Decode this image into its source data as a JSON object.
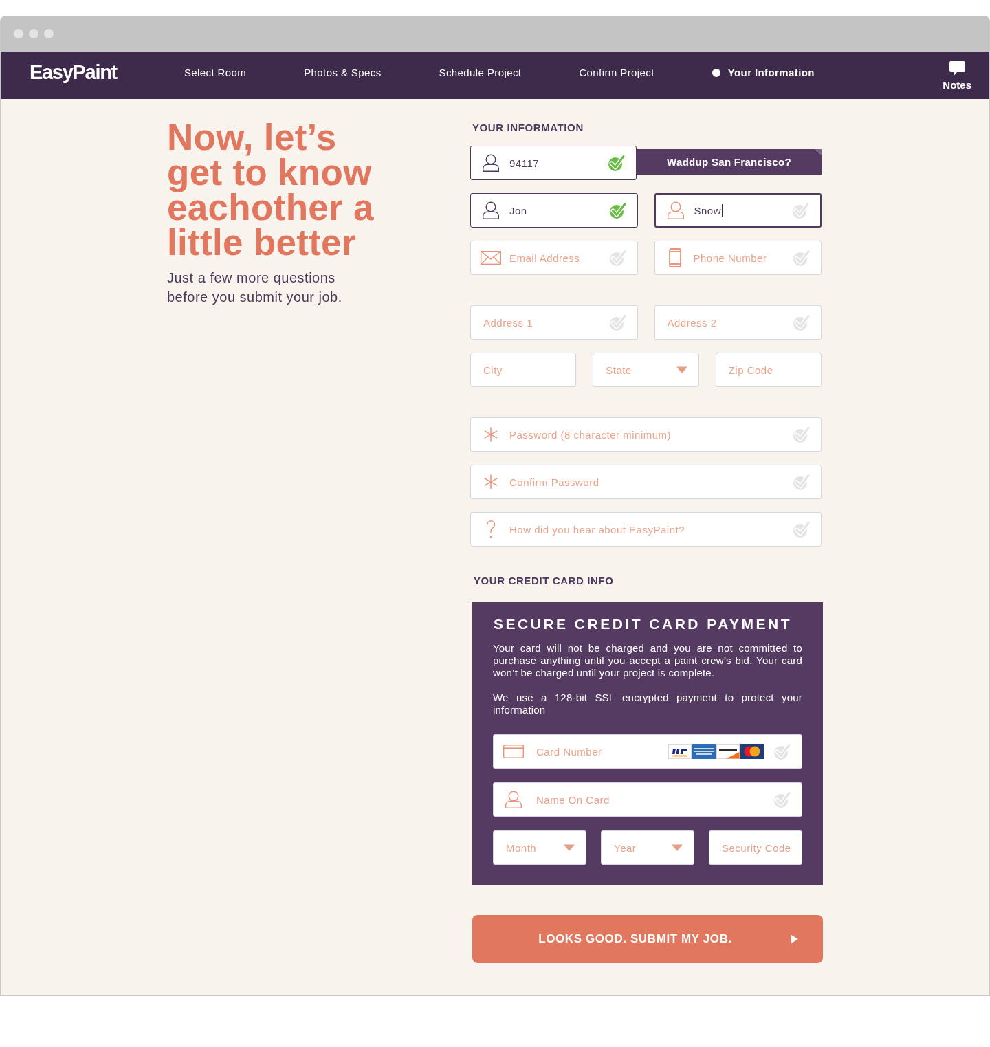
{
  "nav": {
    "logo": "EasyPaint",
    "steps": [
      {
        "label": "Select Room",
        "selected": false
      },
      {
        "label": "Photos & Specs",
        "selected": false
      },
      {
        "label": "Schedule Project",
        "selected": false
      },
      {
        "label": "Confirm Project",
        "selected": false
      },
      {
        "label": "Your Information",
        "selected": true
      }
    ],
    "notes": {
      "label": "Notes"
    }
  },
  "intro": {
    "heading": "Now, let’s\nget to know\neachother a\nlittle better",
    "subtitle": "Just a few more questions before you submit your job."
  },
  "your_information": {
    "title": "YOUR INFORMATION",
    "sections": [
      {
        "rows": [
          {
            "tooltip": "Waddup San Francisco?",
            "fields": [
              {
                "kind": "zip",
                "value": "94117",
                "valid": true,
                "focused": false
              }
            ]
          },
          {
            "fields": [
              {
                "kind": "name",
                "value": "Jon",
                "valid": true,
                "focused": false
              },
              {
                "kind": "name",
                "value": "Snow",
                "valid": false,
                "focused": true
              }
            ]
          },
          {
            "fields": [
              {
                "kind": "email",
                "placeholder": "Email Address",
                "valid": false,
                "focused": false
              },
              {
                "kind": "phone",
                "placeholder": "Phone Number",
                "valid": false,
                "focused": false
              }
            ]
          }
        ]
      },
      {
        "rows": [
          {
            "fields": [
              {
                "kind": "address",
                "placeholder": "Address 1",
                "valid": false,
                "focused": false
              },
              {
                "kind": "address",
                "placeholder": "Address 2",
                "valid": false,
                "focused": false
              }
            ]
          },
          {
            "fields": [
              {
                "kind": "city",
                "placeholder": "City",
                "focused": false
              },
              {
                "kind": "state",
                "placeholder": "State",
                "focused": false
              },
              {
                "kind": "postcode",
                "placeholder": "Zip Code",
                "focused": false
              }
            ]
          }
        ]
      },
      {
        "rows": [
          {
            "fields": [
              {
                "kind": "password",
                "placeholder": "Password (8 character minimum)",
                "valid": false,
                "focused": false
              }
            ]
          },
          {
            "fields": [
              {
                "kind": "password",
                "placeholder": "Confirm Password",
                "valid": false,
                "focused": false
              }
            ]
          },
          {
            "fields": [
              {
                "kind": "referral",
                "placeholder": "How did you hear about EasyPaint?",
                "valid": false,
                "focused": false
              }
            ]
          }
        ]
      }
    ]
  },
  "credit_card": {
    "title": "YOUR CREDIT CARD INFO",
    "panel_title": "SECURE CREDIT CARD PAYMENT",
    "paragraphs": [
      "Your card will not be charged and you are not committed to purchase anything until you accept a paint crew’s bid. Your card won’t be charged until your project is complete.",
      "We use a 128-bit SSL encrypted payment to protect your information"
    ],
    "rows": [
      {
        "fields": [
          {
            "kind": "card",
            "placeholder": "Card Number",
            "valid": false
          }
        ]
      },
      {
        "fields": [
          {
            "kind": "cardholder",
            "placeholder": "Name On Card",
            "valid": false
          }
        ]
      },
      {
        "fields": [
          {
            "kind": "month",
            "placeholder": "Month"
          },
          {
            "kind": "year",
            "placeholder": "Year"
          },
          {
            "kind": "cvc",
            "placeholder": "Security Code"
          }
        ]
      }
    ]
  },
  "submit": {
    "label": "LOOKS GOOD. SUBMIT MY JOB."
  }
}
